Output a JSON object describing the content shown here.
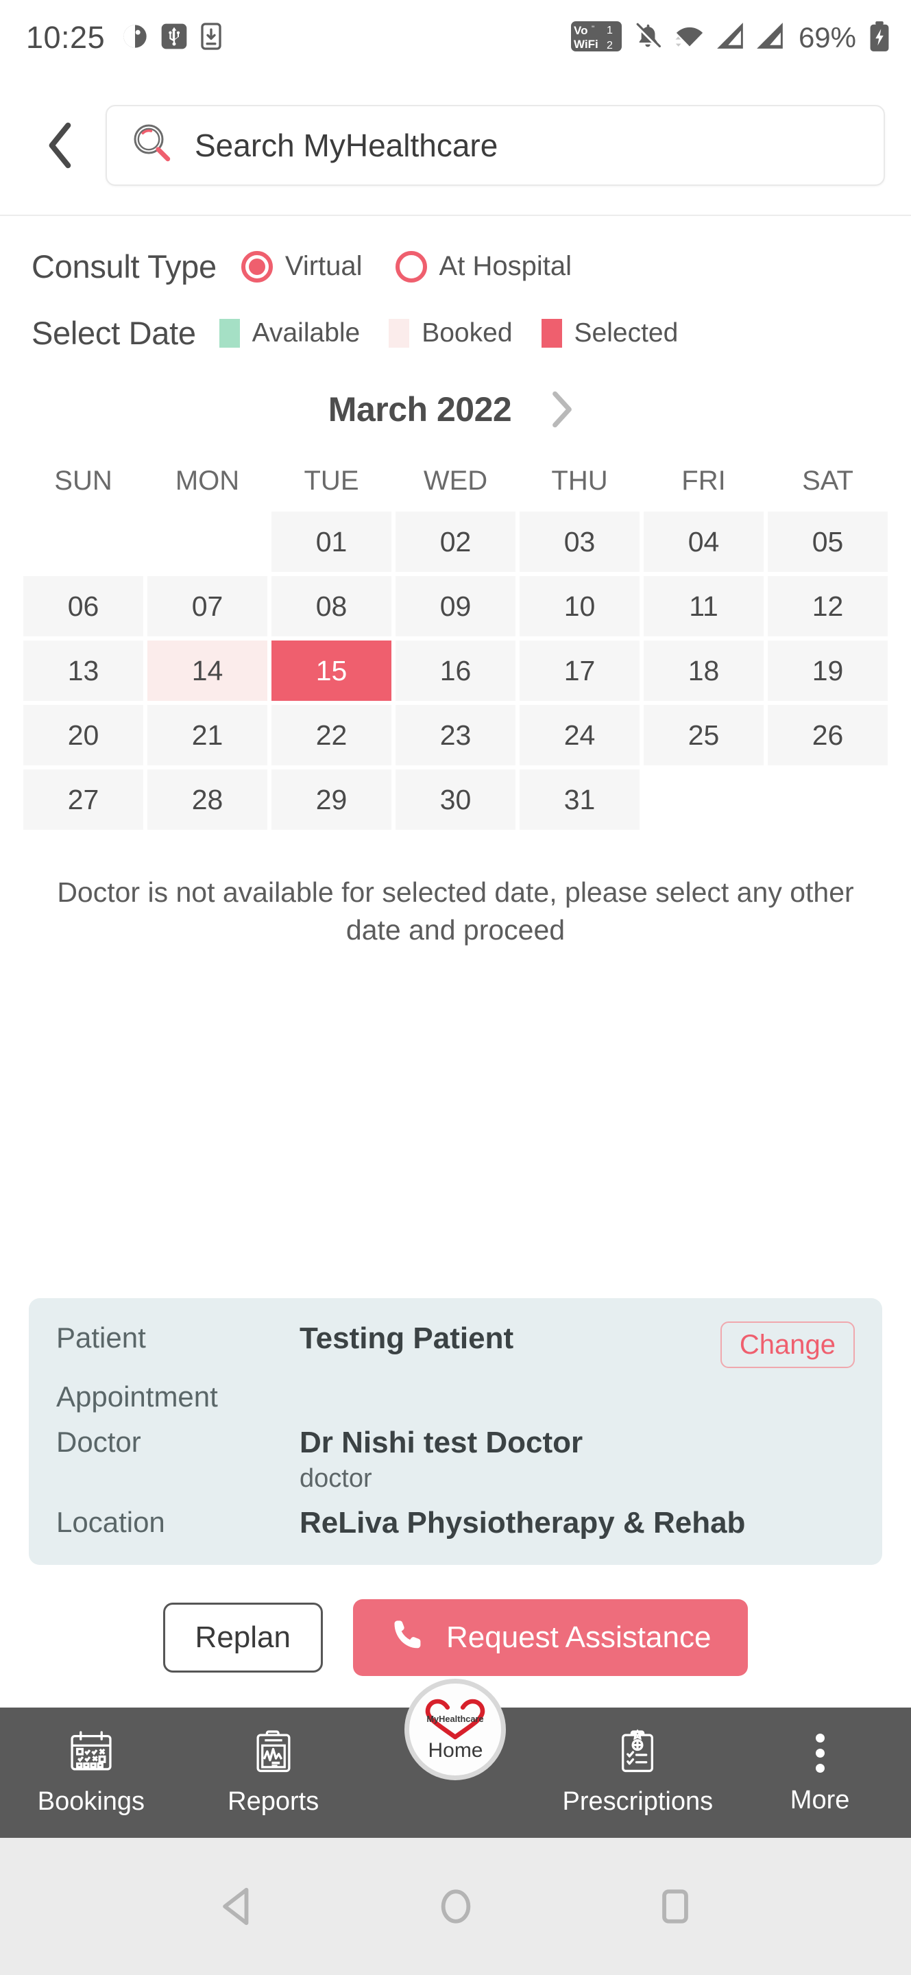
{
  "statusbar": {
    "time": "10:25",
    "battery_percent": "69%",
    "icons_left": [
      "do-not-disturb-icon",
      "usb-icon",
      "phone-download-icon"
    ],
    "icons_right": [
      "volte-wifi-icon",
      "notifications-muted-icon",
      "wifi-icon",
      "signal-1-icon",
      "signal-2-icon",
      "battery-charging-icon"
    ],
    "volte_label_top": "Vo",
    "volte_label_bottom": "WiFi",
    "volte_sim_top": "1",
    "volte_sim_bottom": "2"
  },
  "appbar": {
    "back_icon": "chevron-left-icon",
    "search_placeholder": "Search MyHealthcare",
    "search_value": ""
  },
  "consult": {
    "label": "Consult Type",
    "options": [
      {
        "label": "Virtual",
        "selected": true
      },
      {
        "label": "At Hospital",
        "selected": false
      }
    ]
  },
  "select_date": {
    "label": "Select Date",
    "legend": [
      {
        "label": "Available",
        "color": "#a5e0c5"
      },
      {
        "label": "Booked",
        "color": "#fbeceb"
      },
      {
        "label": "Selected",
        "color": "#ef5f6e"
      }
    ]
  },
  "calendar": {
    "month": "March 2022",
    "next_icon": "chevron-right-icon",
    "day_headers": [
      "SUN",
      "MON",
      "TUE",
      "WED",
      "THU",
      "FRI",
      "SAT"
    ],
    "weeks": [
      [
        {
          "label": "",
          "state": "empty"
        },
        {
          "label": "",
          "state": "empty"
        },
        {
          "label": "01",
          "state": "default"
        },
        {
          "label": "02",
          "state": "default"
        },
        {
          "label": "03",
          "state": "default"
        },
        {
          "label": "04",
          "state": "default"
        },
        {
          "label": "05",
          "state": "default"
        }
      ],
      [
        {
          "label": "06",
          "state": "default"
        },
        {
          "label": "07",
          "state": "default"
        },
        {
          "label": "08",
          "state": "default"
        },
        {
          "label": "09",
          "state": "default"
        },
        {
          "label": "10",
          "state": "default"
        },
        {
          "label": "11",
          "state": "default"
        },
        {
          "label": "12",
          "state": "default"
        }
      ],
      [
        {
          "label": "13",
          "state": "default"
        },
        {
          "label": "14",
          "state": "booked"
        },
        {
          "label": "15",
          "state": "selected"
        },
        {
          "label": "16",
          "state": "default"
        },
        {
          "label": "17",
          "state": "default"
        },
        {
          "label": "18",
          "state": "default"
        },
        {
          "label": "19",
          "state": "default"
        }
      ],
      [
        {
          "label": "20",
          "state": "default"
        },
        {
          "label": "21",
          "state": "default"
        },
        {
          "label": "22",
          "state": "default"
        },
        {
          "label": "23",
          "state": "default"
        },
        {
          "label": "24",
          "state": "default"
        },
        {
          "label": "25",
          "state": "default"
        },
        {
          "label": "26",
          "state": "default"
        }
      ],
      [
        {
          "label": "27",
          "state": "default"
        },
        {
          "label": "28",
          "state": "default"
        },
        {
          "label": "29",
          "state": "default"
        },
        {
          "label": "30",
          "state": "default"
        },
        {
          "label": "31",
          "state": "default"
        },
        {
          "label": "",
          "state": "empty"
        },
        {
          "label": "",
          "state": "empty"
        }
      ]
    ]
  },
  "notice": "Doctor is not available for selected date, please select any other date and proceed",
  "info_card": {
    "patient_key": "Patient",
    "patient_value": "Testing Patient",
    "change_label": "Change",
    "appointment_key": "Appointment",
    "appointment_value": "",
    "doctor_key": "Doctor",
    "doctor_value": "Dr Nishi  test Doctor",
    "doctor_sub": "doctor",
    "location_key": "Location",
    "location_value": "ReLiva Physiotherapy & Rehab"
  },
  "actions": {
    "replan_label": "Replan",
    "assistance_label": "Request Assistance",
    "assistance_icon": "phone-icon"
  },
  "tabbar": {
    "tabs": [
      {
        "label": "Bookings",
        "icon": "calendar-check-icon"
      },
      {
        "label": "Reports",
        "icon": "clipboard-chart-icon"
      },
      {
        "label": "Home",
        "icon": "heart-logo-icon"
      },
      {
        "label": "Prescriptions",
        "icon": "clipboard-prescription-icon"
      },
      {
        "label": "More",
        "icon": "more-vertical-icon"
      }
    ],
    "home_logo_text": "MyHealthcare"
  },
  "androidnav": {
    "back_icon": "triangle-back-icon",
    "home_icon": "circle-home-icon",
    "recents_icon": "square-recents-icon"
  },
  "theme": {
    "accent": "#ef5f6e",
    "card_bg": "#e6eef0",
    "day_bg": "#f6f6f6",
    "tabbar_bg": "#5a5a5a"
  }
}
